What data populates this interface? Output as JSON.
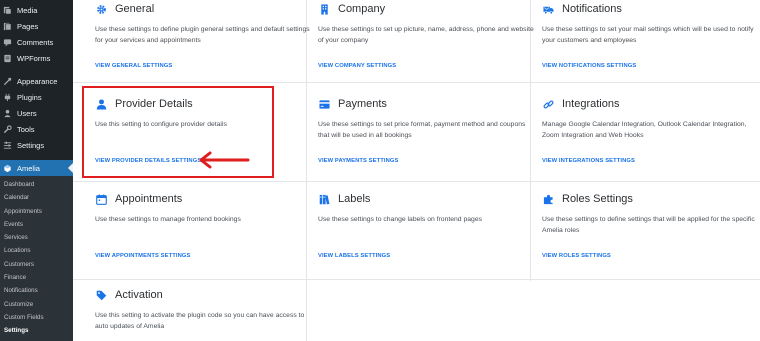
{
  "sidebar": {
    "top_items": [
      {
        "label": "Media",
        "icon": "media-icon"
      },
      {
        "label": "Pages",
        "icon": "pages-icon"
      },
      {
        "label": "Comments",
        "icon": "comments-icon"
      },
      {
        "label": "WPForms",
        "icon": "wpforms-icon"
      },
      {
        "label": "Appearance",
        "icon": "appearance-icon"
      },
      {
        "label": "Plugins",
        "icon": "plugins-icon"
      },
      {
        "label": "Users",
        "icon": "users-icon"
      },
      {
        "label": "Tools",
        "icon": "tools-icon"
      },
      {
        "label": "Settings",
        "icon": "settings-icon"
      }
    ],
    "active_item": {
      "label": "Amelia",
      "icon": "amelia-icon"
    },
    "submenu": [
      "Dashboard",
      "Calendar",
      "Appointments",
      "Events",
      "Services",
      "Locations",
      "Customers",
      "Finance",
      "Notifications",
      "Customize",
      "Custom Fields",
      "Settings"
    ],
    "submenu_current": "Settings"
  },
  "cards": {
    "general": {
      "title": "General",
      "desc": "Use these settings to define plugin general settings and default settings for your services and appointments",
      "link": "VIEW GENERAL SETTINGS",
      "icon": "gear-icon"
    },
    "company": {
      "title": "Company",
      "desc": "Use these settings to set up picture, name, address, phone and website of your company",
      "link": "VIEW COMPANY SETTINGS",
      "icon": "building-icon"
    },
    "notifications": {
      "title": "Notifications",
      "desc": "Use these settings to set your mail settings which will be used to notify your customers and employees",
      "link": "VIEW NOTIFICATIONS SETTINGS",
      "icon": "truck-mail-icon"
    },
    "provider": {
      "title": "Provider Details",
      "desc": "Use this setting to configure provider details",
      "link": "VIEW PROVIDER DETAILS SETTINGS",
      "icon": "user-icon"
    },
    "payments": {
      "title": "Payments",
      "desc": "Use these settings to set price format, payment method and coupons that will be used in all bookings",
      "link": "VIEW PAYMENTS SETTINGS",
      "icon": "credit-card-icon"
    },
    "integrations": {
      "title": "Integrations",
      "desc": "Manage Google Calendar Integration, Outlook Calendar Integration, Zoom Integration and Web Hooks",
      "link": "VIEW INTEGRATIONS SETTINGS",
      "icon": "link-icon"
    },
    "appointments": {
      "title": "Appointments",
      "desc": "Use these settings to manage frontend bookings",
      "link": "VIEW APPOINTMENTS SETTINGS",
      "icon": "calendar-icon"
    },
    "labels": {
      "title": "Labels",
      "desc": "Use these settings to change labels on frontend pages",
      "link": "VIEW LABELS SETTINGS",
      "icon": "books-icon"
    },
    "roles": {
      "title": "Roles Settings",
      "desc": "Use these settings to define settings that will be applied for the specific Amelia roles",
      "link": "VIEW ROLES SETTINGS",
      "icon": "puzzle-icon"
    },
    "activation": {
      "title": "Activation",
      "desc": "Use this setting to activate the plugin code so you can have access to auto updates of Amelia",
      "link": "",
      "icon": "tag-icon"
    }
  },
  "colors": {
    "accent": "#1a73e8",
    "highlight": "#e01e1e",
    "sidebar_bg": "#1d2327",
    "active_bg": "#2271b1"
  }
}
